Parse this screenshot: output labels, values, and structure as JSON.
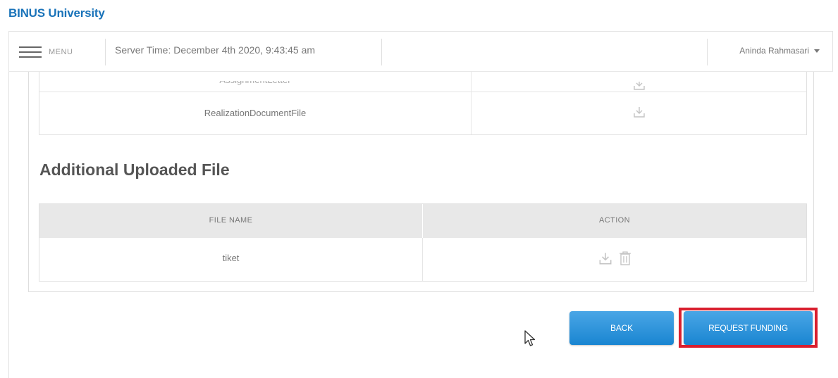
{
  "header": {
    "brand": "BINUS University",
    "menu_label": "MENU",
    "server_time": "Server Time: December 4th 2020, 9:43:45 am",
    "user_name": "Aninda Rahmasari"
  },
  "documents": {
    "rows": [
      {
        "name": "AssignmentLetter",
        "action_icon": "download-icon"
      },
      {
        "name": "RealizationDocumentFile",
        "action_icon": "download-icon"
      }
    ]
  },
  "additional": {
    "title": "Additional Uploaded File",
    "columns": [
      "FILE NAME",
      "ACTION"
    ],
    "rows": [
      {
        "file_name": "tiket",
        "actions": [
          "download-icon",
          "trash-icon"
        ]
      }
    ]
  },
  "buttons": {
    "back": "BACK",
    "request_funding": "REQUEST FUNDING"
  },
  "colors": {
    "brand": "#1a73b9",
    "button": "#1985d1",
    "highlight": "#d91f2e",
    "table_header": "#e8e8e8"
  }
}
